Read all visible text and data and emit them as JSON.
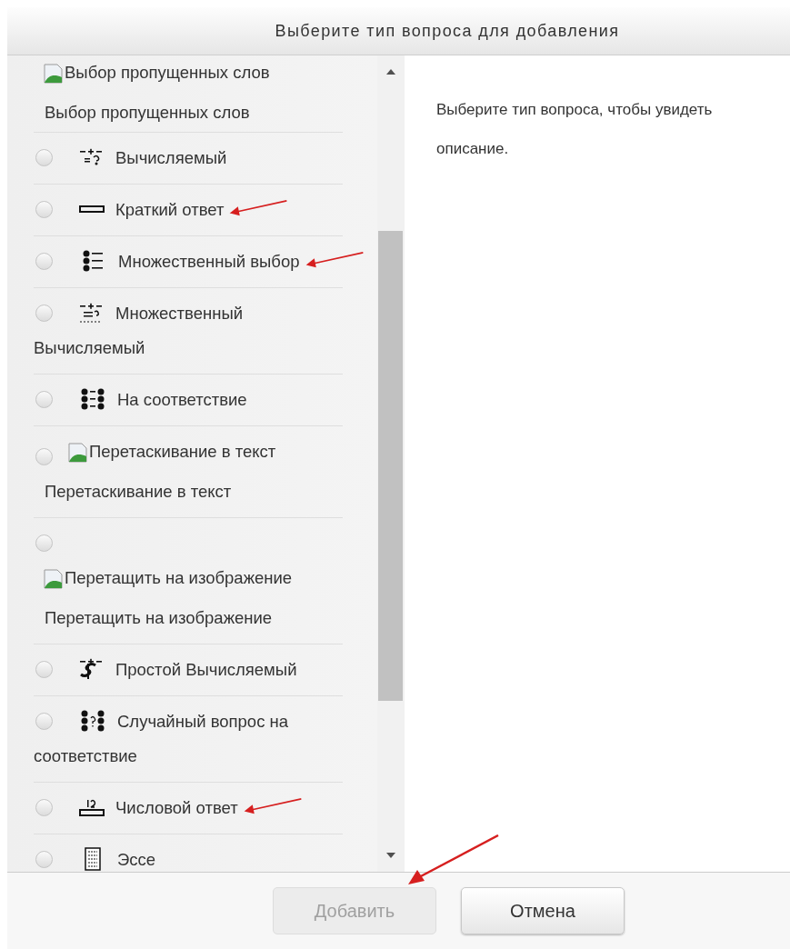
{
  "dialog": {
    "title": "Выберите тип вопроса для добавления"
  },
  "items": [
    {
      "kind": "gapselect",
      "marked": false,
      "label": "Выбор пропущенных слов",
      "image_alt": "Выбор пропущенных слов"
    },
    {
      "kind": "calculated",
      "selected": false,
      "marked": false,
      "label": "Вычисляемый"
    },
    {
      "kind": "shortanswer",
      "selected": false,
      "marked": true,
      "label": "Краткий ответ"
    },
    {
      "kind": "multichoice",
      "selected": false,
      "marked": true,
      "label": "Множественный выбор"
    },
    {
      "kind": "calculatedmulti",
      "selected": false,
      "marked": false,
      "label": "Множественный Вычисляемый"
    },
    {
      "kind": "match",
      "selected": false,
      "marked": false,
      "label": "На соответствие"
    },
    {
      "kind": "ddwtos",
      "selected": false,
      "marked": false,
      "label": "Перетаскивание в текст",
      "image_alt": "Перетаскивание в текст"
    },
    {
      "kind": "ddimageortext",
      "selected": false,
      "marked": false,
      "label": "Перетащить на изображение",
      "image_alt": "Перетащить на изображение"
    },
    {
      "kind": "calculatedsimple",
      "selected": false,
      "marked": false,
      "label": "Простой Вычисляемый"
    },
    {
      "kind": "randomsamatch",
      "selected": false,
      "marked": false,
      "label": "Случайный вопрос на соответствие"
    },
    {
      "kind": "numerical",
      "selected": false,
      "marked": true,
      "label": "Числовой ответ"
    },
    {
      "kind": "essay",
      "selected": false,
      "marked": false,
      "label": "Эссе"
    }
  ],
  "description": "Выберите тип вопроса, чтобы увидеть описание.",
  "buttons": [
    {
      "label": "Добавить",
      "disabled": true,
      "marked": true
    },
    {
      "label": "Отмена",
      "disabled": false,
      "marked": false
    }
  ]
}
